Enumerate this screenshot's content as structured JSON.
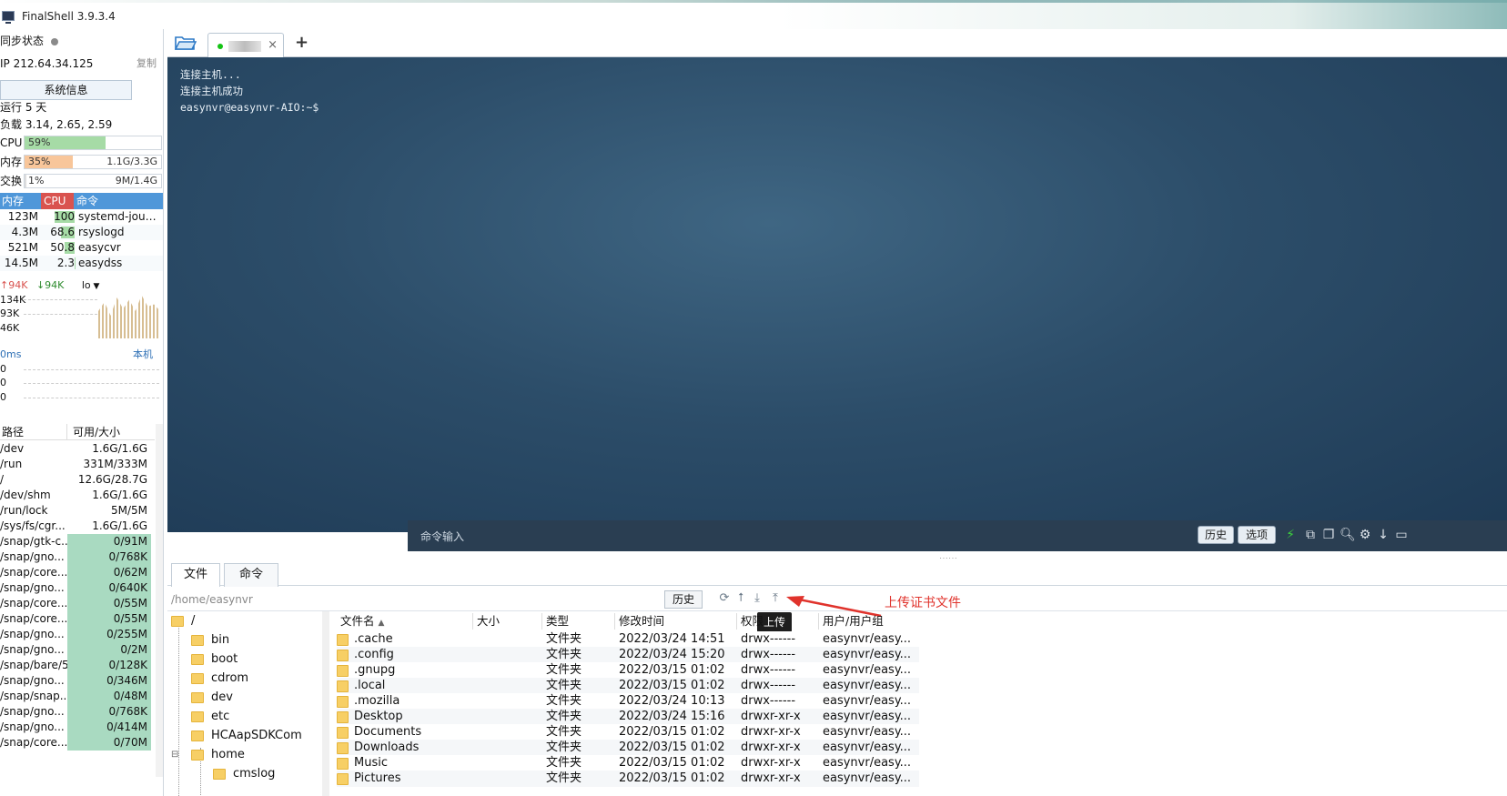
{
  "window": {
    "title": "FinalShell 3.9.3.4"
  },
  "sidebar": {
    "sync_label": "同步状态",
    "ip": "IP 212.64.34.125",
    "copy": "复制",
    "sysinfo": "系统信息",
    "uptime": "运行 5 天",
    "load": "负载 3.14, 2.65, 2.59",
    "cpu": {
      "label": "CPU",
      "pct": "59%",
      "value": 0.59,
      "color": "#a6dba6"
    },
    "mem": {
      "label": "内存",
      "pct": "35%",
      "detail": "1.1G/3.3G",
      "value": 0.35,
      "color": "#f8c69a"
    },
    "swap": {
      "label": "交换",
      "pct": "1%",
      "detail": "9M/1.4G",
      "value": 0.01,
      "color": "#ddd"
    },
    "proc_header": {
      "mem": "内存",
      "cpu": "CPU",
      "cmd": "命令"
    },
    "processes": [
      {
        "mem": "123M",
        "cpu": "100",
        "cmd": "systemd-journ..."
      },
      {
        "mem": "4.3M",
        "cpu": "68.6",
        "cmd": "rsyslogd"
      },
      {
        "mem": "521M",
        "cpu": "50.8",
        "cmd": "easycvr"
      },
      {
        "mem": "14.5M",
        "cpu": "2.3",
        "cmd": "easydss"
      }
    ],
    "net": {
      "up": "94K",
      "down": "94K",
      "iface": "lo",
      "scale": [
        "134K",
        "93K",
        "46K"
      ]
    },
    "latency": {
      "label": "0ms",
      "host": "本机",
      "values": [
        "0",
        "0",
        "0"
      ]
    },
    "fs_header": {
      "path": "路径",
      "size": "可用/大小"
    },
    "filesystems": [
      {
        "path": "/dev",
        "size": "1.6G/1.6G",
        "full": false
      },
      {
        "path": "/run",
        "size": "331M/333M",
        "full": false
      },
      {
        "path": "/",
        "size": "12.6G/28.7G",
        "full": false
      },
      {
        "path": "/dev/shm",
        "size": "1.6G/1.6G",
        "full": false
      },
      {
        "path": "/run/lock",
        "size": "5M/5M",
        "full": false
      },
      {
        "path": "/sys/fs/cgr...",
        "size": "1.6G/1.6G",
        "full": false
      },
      {
        "path": "/snap/gtk-c...",
        "size": "0/91M",
        "full": true
      },
      {
        "path": "/snap/gno...",
        "size": "0/768K",
        "full": true
      },
      {
        "path": "/snap/core...",
        "size": "0/62M",
        "full": true
      },
      {
        "path": "/snap/gno...",
        "size": "0/640K",
        "full": true
      },
      {
        "path": "/snap/core...",
        "size": "0/55M",
        "full": true
      },
      {
        "path": "/snap/core...",
        "size": "0/55M",
        "full": true
      },
      {
        "path": "/snap/gno...",
        "size": "0/255M",
        "full": true
      },
      {
        "path": "/snap/gno...",
        "size": "0/2M",
        "full": true
      },
      {
        "path": "/snap/bare/5",
        "size": "0/128K",
        "full": true
      },
      {
        "path": "/snap/gno...",
        "size": "0/346M",
        "full": true
      },
      {
        "path": "/snap/snap...",
        "size": "0/48M",
        "full": true
      },
      {
        "path": "/snap/gno...",
        "size": "0/768K",
        "full": true
      },
      {
        "path": "/snap/gno...",
        "size": "0/414M",
        "full": true
      },
      {
        "path": "/snap/core...",
        "size": "0/70M",
        "full": true
      }
    ]
  },
  "tabs": {
    "plus": "+",
    "close": "×"
  },
  "terminal": {
    "lines": [
      "连接主机...",
      "连接主机成功",
      "easynvr@easynvr-AIO:~$"
    ],
    "command_placeholder": "命令输入",
    "history_btn": "历史",
    "options_btn": "选项"
  },
  "files": {
    "tab_files": "文件",
    "tab_commands": "命令",
    "path": "/home/easynvr",
    "history_btn": "历史",
    "tooltip": "上传",
    "annotation": "上传证书文件",
    "tree": [
      {
        "name": "/",
        "level": 0
      },
      {
        "name": "bin",
        "level": 1
      },
      {
        "name": "boot",
        "level": 1
      },
      {
        "name": "cdrom",
        "level": 1
      },
      {
        "name": "dev",
        "level": 1
      },
      {
        "name": "etc",
        "level": 1
      },
      {
        "name": "HCAapSDKCom",
        "level": 1
      },
      {
        "name": "home",
        "level": 1
      },
      {
        "name": "cmslog",
        "level": 2
      }
    ],
    "columns": {
      "name": "文件名",
      "size": "大小",
      "type": "类型",
      "modified": "修改时间",
      "perm": "权限",
      "owner": "用户/用户组"
    },
    "rows": [
      {
        "name": ".cache",
        "size": "",
        "type": "文件夹",
        "modified": "2022/03/24 14:51",
        "perm": "drwx------",
        "owner": "easynvr/easy..."
      },
      {
        "name": ".config",
        "size": "",
        "type": "文件夹",
        "modified": "2022/03/24 15:20",
        "perm": "drwx------",
        "owner": "easynvr/easy..."
      },
      {
        "name": ".gnupg",
        "size": "",
        "type": "文件夹",
        "modified": "2022/03/15 01:02",
        "perm": "drwx------",
        "owner": "easynvr/easy..."
      },
      {
        "name": ".local",
        "size": "",
        "type": "文件夹",
        "modified": "2022/03/15 01:02",
        "perm": "drwx------",
        "owner": "easynvr/easy..."
      },
      {
        "name": ".mozilla",
        "size": "",
        "type": "文件夹",
        "modified": "2022/03/24 10:13",
        "perm": "drwx------",
        "owner": "easynvr/easy..."
      },
      {
        "name": "Desktop",
        "size": "",
        "type": "文件夹",
        "modified": "2022/03/24 15:16",
        "perm": "drwxr-xr-x",
        "owner": "easynvr/easy..."
      },
      {
        "name": "Documents",
        "size": "",
        "type": "文件夹",
        "modified": "2022/03/15 01:02",
        "perm": "drwxr-xr-x",
        "owner": "easynvr/easy..."
      },
      {
        "name": "Downloads",
        "size": "",
        "type": "文件夹",
        "modified": "2022/03/15 01:02",
        "perm": "drwxr-xr-x",
        "owner": "easynvr/easy..."
      },
      {
        "name": "Music",
        "size": "",
        "type": "文件夹",
        "modified": "2022/03/15 01:02",
        "perm": "drwxr-xr-x",
        "owner": "easynvr/easy..."
      },
      {
        "name": "Pictures",
        "size": "",
        "type": "文件夹",
        "modified": "2022/03/15 01:02",
        "perm": "drwxr-xr-x",
        "owner": "easynvr/easy..."
      }
    ]
  }
}
